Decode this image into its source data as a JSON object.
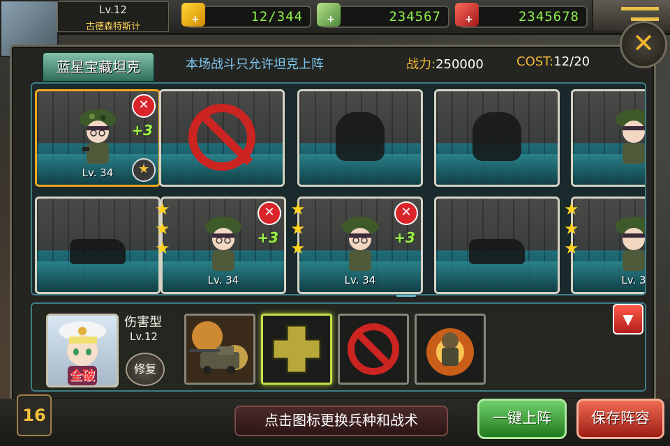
{
  "player": {
    "level": "Lv.12",
    "name": "古德森特斯计"
  },
  "resources": [
    {
      "name": "energy",
      "icon": "lightning-icon",
      "value": "12/344"
    },
    {
      "name": "money",
      "icon": "cash-icon",
      "value": "234567"
    },
    {
      "name": "ammo",
      "icon": "ammo-icon",
      "value": "2345678"
    }
  ],
  "panel": {
    "map_title": "蓝星宝藏坦克",
    "notice": "本场战斗只允许坦克上阵",
    "power_label": "战力:",
    "power_value": "250000",
    "cost_label": "COST:",
    "cost_value": "12/20"
  },
  "slots": [
    {
      "type": "soldier",
      "level": "Lv. 34",
      "plus": "+3",
      "stars": 0,
      "removable": true,
      "selected": true
    },
    {
      "type": "forbidden"
    },
    {
      "type": "empty-soldier"
    },
    {
      "type": "empty-soldier"
    },
    {
      "type": "soldier",
      "level": "",
      "plus": "",
      "stars": 0
    },
    {
      "type": "empty-tank"
    },
    {
      "type": "soldier",
      "level": "Lv. 34",
      "plus": "+3",
      "stars": 3,
      "removable": true
    },
    {
      "type": "soldier",
      "level": "Lv. 34",
      "plus": "+3",
      "stars": 3,
      "removable": true
    },
    {
      "type": "empty-tank"
    },
    {
      "type": "soldier",
      "level": "Lv. 3",
      "plus": "",
      "stars": 3
    }
  ],
  "commander": {
    "status": "全破",
    "type": "伤害型",
    "level": "Lv.12",
    "repair_label": "修复"
  },
  "tactics": [
    "fire-tank-tactic",
    "repair-plus-tactic",
    "forbidden-tactic",
    "explosion-soldier-tactic"
  ],
  "footer": {
    "page_number": "16",
    "hint": "点击图标更换兵种和战术",
    "deploy_label": "一键上阵",
    "save_label": "保存阵容"
  },
  "colors": {
    "resource_value": "#8ef04a",
    "notice": "#7ec6ee",
    "label_gold": "#f0b53a",
    "forbid_red": "#cc2420",
    "deploy_green": "#227a1e",
    "save_red": "#9e1d14"
  }
}
